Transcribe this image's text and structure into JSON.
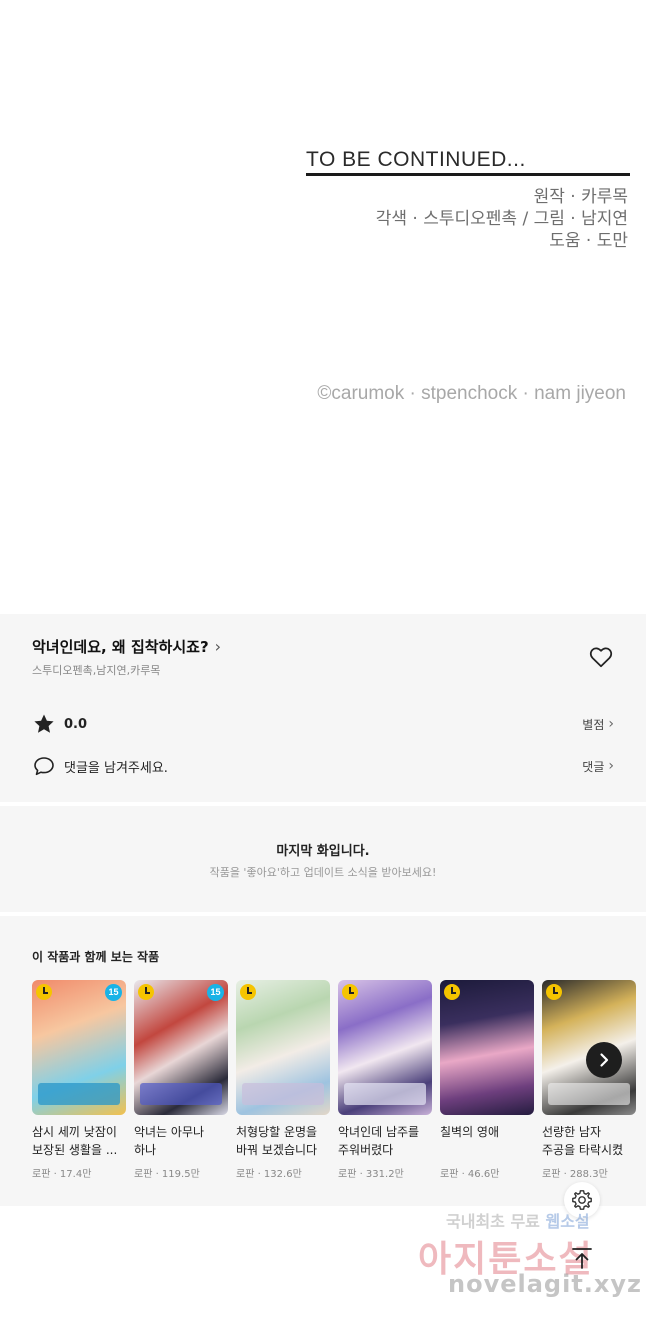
{
  "end_panel": {
    "tbc": "TO BE CONTINUED...",
    "credit_original": "원작 · 카루목",
    "credit_adapt": "각색 · 스투디오펜촉 / 그림 · 남지연",
    "credit_assist": "도움 · 도만",
    "copyright": "©carumok · stpenchock · nam jiyeon"
  },
  "work": {
    "title": "악녀인데요, 왜 집착하시죠?",
    "authors": "스투디오펜촉,남지연,카루목",
    "rating": "0.0",
    "rating_link": "별점",
    "comment_prompt": "댓글을 남겨주세요.",
    "comment_link": "댓글"
  },
  "notice": {
    "title": "마지막 화입니다.",
    "subtitle": "작품을 '좋아요'하고 업데이트 소식을 받아보세요!"
  },
  "recommendations": {
    "heading": "이 작품과 함께 보는 작품",
    "items": [
      {
        "title": "삼시 세끼 낮잠이 보장된 생활을 ...",
        "meta": "로판 · 17.4만",
        "age": "15"
      },
      {
        "title": "악녀는 아무나 하나",
        "meta": "로판 · 119.5만",
        "age": "15"
      },
      {
        "title": "처형당할 운명을 바꿔 보겠습니다",
        "meta": "로판 · 132.6만"
      },
      {
        "title": "악녀인데 남주를 주워버렸다",
        "meta": "로판 · 331.2만"
      },
      {
        "title": "칠벽의 영애",
        "meta": "로판 · 46.6만"
      },
      {
        "title": "선량한 남자 주공을 타락시켰",
        "meta": "로판 · 288.3만"
      }
    ]
  },
  "watermark": {
    "line1_a": "국내최초 무료 ",
    "line1_b": "웹소설",
    "line2": "아지툰소설",
    "line3": "novelagit.xyz"
  },
  "colors": {
    "section_bg": "#f6f6f6",
    "badge_age": "#1ab3e6",
    "badge_wait": "#f5c400"
  },
  "icons": [
    "heart-icon",
    "star-icon",
    "comment-icon",
    "chevron-right-icon",
    "clock-icon",
    "gear-icon",
    "arrow-up-icon"
  ]
}
